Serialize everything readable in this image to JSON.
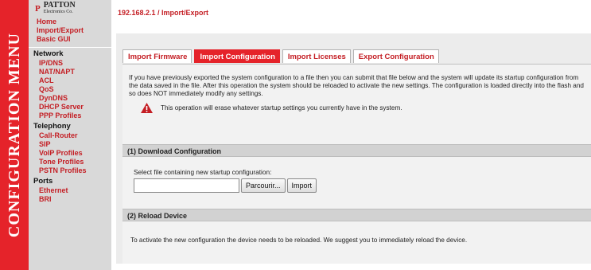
{
  "side_band": {
    "text": "CONFIGURATION MENU"
  },
  "logo": {
    "mark": "P",
    "text": "PATTON",
    "subtext": "Electronics Co."
  },
  "nav": {
    "top_links": [
      "Home",
      "Import/Export",
      "Basic GUI"
    ],
    "groups": [
      {
        "title": "Network",
        "items": [
          "IP/DNS",
          "NAT/NAPT",
          "ACL",
          "QoS",
          "DynDNS",
          "DHCP Server",
          "PPP Profiles"
        ]
      },
      {
        "title": "Telephony",
        "items": [
          "Call-Router",
          "SIP",
          "VoIP Profiles",
          "Tone Profiles",
          "PSTN Profiles"
        ]
      },
      {
        "title": "Ports",
        "items": [
          "Ethernet",
          "BRI"
        ]
      }
    ]
  },
  "breadcrumb": "192.168.2.1 / Import/Export",
  "tabs": [
    {
      "label": "Import Firmware",
      "active": false
    },
    {
      "label": "Import Configuration",
      "active": true
    },
    {
      "label": "Import Licenses",
      "active": false
    },
    {
      "label": "Export Configuration",
      "active": false
    }
  ],
  "intro_text": "If you have previously exported the system configuration to a file then you can submit that file below and the system will update its startup configuration from the data saved in the file. After this operation the system should be reloaded to activate the new settings. The configuration is loaded directly into the flash and so does NOT immediately modify any settings.",
  "warning": {
    "icon": "warning-icon",
    "text": "This operation will erase whatever startup settings you currently have in the system."
  },
  "section1": {
    "title": "(1) Download Configuration",
    "label": "Select file containing new startup configuration:",
    "file_value": "",
    "browse_label": "Parcourir...",
    "import_label": "Import"
  },
  "section2": {
    "title": "(2) Reload Device",
    "text": "To activate the new configuration the device needs to be reloaded. We suggest you to immediately reload the device."
  },
  "colors": {
    "brand_red": "#e5232a",
    "link_red": "#c41e24",
    "sidebar_gray": "#d9d9d9"
  }
}
